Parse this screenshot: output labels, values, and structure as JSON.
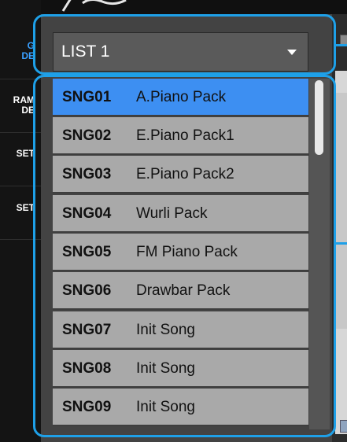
{
  "sidebar": {
    "items": [
      {
        "label": "G\nDE",
        "active": true
      },
      {
        "label": "RAM\nDE",
        "active": false
      },
      {
        "label": "SET",
        "active": false
      },
      {
        "label": "SET",
        "active": false
      }
    ]
  },
  "dropdown": {
    "selected": "LIST 1"
  },
  "list": {
    "items": [
      {
        "id": "SNG01",
        "name": "A.Piano Pack",
        "selected": true
      },
      {
        "id": "SNG02",
        "name": "E.Piano Pack1",
        "selected": false
      },
      {
        "id": "SNG03",
        "name": "E.Piano Pack2",
        "selected": false
      },
      {
        "id": "SNG04",
        "name": "Wurli Pack",
        "selected": false
      },
      {
        "id": "SNG05",
        "name": "FM Piano Pack",
        "selected": false
      },
      {
        "id": "SNG06",
        "name": "Drawbar Pack",
        "selected": false
      },
      {
        "id": "SNG07",
        "name": "Init Song",
        "selected": false
      },
      {
        "id": "SNG08",
        "name": "Init Song",
        "selected": false
      },
      {
        "id": "SNG09",
        "name": "Init Song",
        "selected": false
      }
    ]
  },
  "colors": {
    "accent": "#1ea0e8",
    "selected_row": "#3d8ff2",
    "row": "#a9a9a9",
    "sidebar_active": "#3aa0ff"
  }
}
